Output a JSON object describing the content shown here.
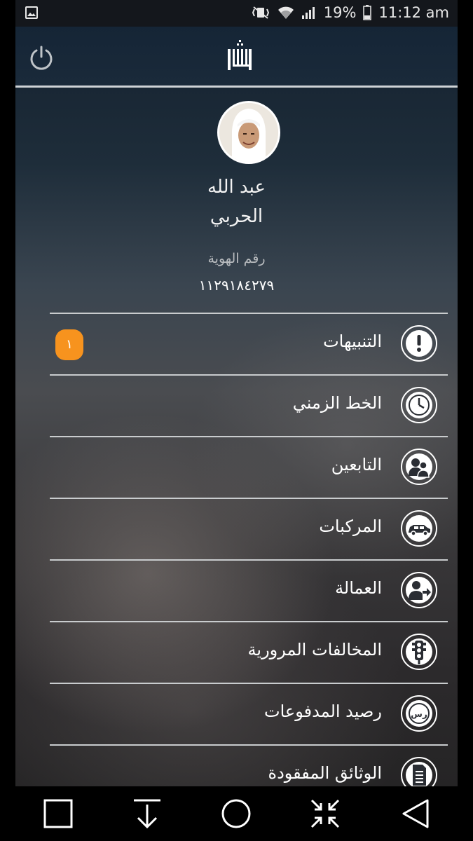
{
  "status_bar": {
    "battery": "19%",
    "time": "11:12 am"
  },
  "header": {
    "logo_icon": "absher-logo",
    "power_icon": "power-icon"
  },
  "profile": {
    "first_name": "عبد الله",
    "last_name": "الحربي",
    "id_label": "رقم الهوية",
    "id_number": "١١٢٩١٨٤٢٧٩"
  },
  "menu": {
    "items": [
      {
        "label": "التنبيهات",
        "icon": "alert-icon",
        "badge": "١"
      },
      {
        "label": "الخط الزمني",
        "icon": "clock-icon"
      },
      {
        "label": "التابعين",
        "icon": "dependents-icon"
      },
      {
        "label": "المركبات",
        "icon": "car-icon"
      },
      {
        "label": "العمالة",
        "icon": "labor-icon"
      },
      {
        "label": "المخالفات المرورية",
        "icon": "traffic-light-icon"
      },
      {
        "label": "رصيد المدفوعات",
        "icon": "riyal-icon",
        "riyal_symbol": "رس"
      },
      {
        "label": "الوثائق المفقودة",
        "icon": "document-icon"
      }
    ]
  },
  "colors": {
    "badge": "#f7931e",
    "header": "#152536"
  }
}
